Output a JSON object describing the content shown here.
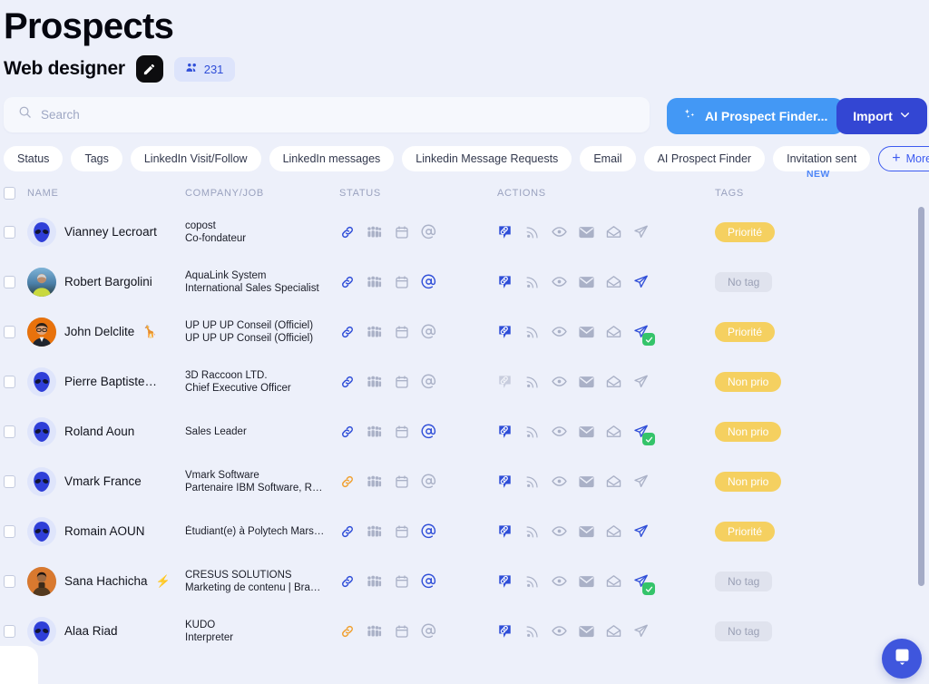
{
  "header": {
    "page_title": "Prospects",
    "campaign_name": "Web designer",
    "edit_icon": "pen-icon",
    "member_count": "231",
    "members_icon": "people-icon"
  },
  "search": {
    "placeholder": "Search",
    "value": "",
    "icon": "search-icon"
  },
  "toolbar": {
    "ai_button_label": "AI Prospect Finder...",
    "ai_button_icon": "sparkles-icon",
    "new_badge": "NEW",
    "import_label": "Import",
    "import_icon": "chevron-down-icon",
    "ai_button_color": "#4398f5",
    "import_button_color": "#3346d3"
  },
  "filters": [
    {
      "label": "Status"
    },
    {
      "label": "Tags"
    },
    {
      "label": "LinkedIn Visit/Follow"
    },
    {
      "label": "LinkedIn messages"
    },
    {
      "label": "Linkedin Message Requests"
    },
    {
      "label": "Email"
    },
    {
      "label": "AI Prospect Finder"
    },
    {
      "label": "Invitation sent"
    }
  ],
  "more_filters": {
    "label": "More filters",
    "icon": "plus-icon",
    "color": "#3d5bf0"
  },
  "table": {
    "columns": [
      "NAME",
      "COMPANY/JOB",
      "STATUS",
      "ACTIONS",
      "TAGS"
    ],
    "status_icons": [
      "link-icon",
      "people-icon",
      "calendar-icon",
      "at-icon"
    ],
    "action_icons": [
      "link-bubble-icon",
      "signal-icon",
      "eye-icon",
      "envelope-icon",
      "open-envelope-icon",
      "paper-plane-icon"
    ],
    "rows": [
      {
        "name": "Vianney Lecroart",
        "emoji": "",
        "avatar": "alien",
        "company": "copost",
        "job": "Co-fondateur",
        "status": [
          "blue",
          "gray",
          "gray",
          "gray"
        ],
        "actions": [
          "active",
          "gray",
          "gray",
          "gray",
          "gray",
          "gray"
        ],
        "sent_check": false,
        "tag": "Priorité",
        "tag_type": "yellow"
      },
      {
        "name": "Robert Bargolini",
        "emoji": "",
        "avatar": "photo-1",
        "company": "AquaLink System",
        "job": "International Sales Specialist",
        "status": [
          "blue",
          "gray",
          "gray",
          "blue"
        ],
        "actions": [
          "active",
          "gray",
          "gray",
          "gray",
          "gray",
          "blue"
        ],
        "sent_check": false,
        "tag": "No tag",
        "tag_type": "none"
      },
      {
        "name": "John Delclite",
        "emoji": "🦒",
        "avatar": "photo-2",
        "company": "UP UP UP Conseil (Officiel)",
        "job": "UP UP UP Conseil (Officiel)",
        "status": [
          "blue",
          "gray",
          "gray",
          "gray"
        ],
        "actions": [
          "active",
          "gray",
          "gray",
          "gray",
          "gray",
          "blue"
        ],
        "sent_check": true,
        "tag": "Priorité",
        "tag_type": "yellow"
      },
      {
        "name": "Pierre Baptiste…",
        "emoji": "",
        "avatar": "alien",
        "company": "3D Raccoon LTD.",
        "job": "Chief Executive Officer",
        "status": [
          "blue",
          "gray",
          "gray",
          "gray"
        ],
        "actions": [
          "gray",
          "gray",
          "gray",
          "gray",
          "gray",
          "gray"
        ],
        "sent_check": false,
        "tag": "Non prio",
        "tag_type": "yellow"
      },
      {
        "name": "Roland Aoun",
        "emoji": "",
        "avatar": "alien",
        "company": "",
        "job": "Sales Leader",
        "status": [
          "blue",
          "gray",
          "gray",
          "blue"
        ],
        "actions": [
          "active",
          "gray",
          "gray",
          "gray",
          "gray",
          "blue"
        ],
        "sent_check": true,
        "tag": "Non prio",
        "tag_type": "yellow"
      },
      {
        "name": "Vmark France",
        "emoji": "",
        "avatar": "alien",
        "company": "Vmark Software",
        "job": "Partenaire IBM Software, R…",
        "status": [
          "orange",
          "gray",
          "gray",
          "gray"
        ],
        "actions": [
          "active",
          "gray",
          "gray",
          "gray",
          "gray",
          "gray"
        ],
        "sent_check": false,
        "tag": "Non prio",
        "tag_type": "yellow"
      },
      {
        "name": "Romain AOUN",
        "emoji": "",
        "avatar": "alien",
        "company": "",
        "job": "Étudiant(e) à Polytech Mars…",
        "status": [
          "blue",
          "gray",
          "gray",
          "blue"
        ],
        "actions": [
          "active",
          "gray",
          "gray",
          "gray",
          "gray",
          "blue"
        ],
        "sent_check": false,
        "tag": "Priorité",
        "tag_type": "yellow"
      },
      {
        "name": "Sana Hachicha",
        "emoji": "⚡",
        "avatar": "photo-3",
        "company": "CRESUS SOLUTIONS",
        "job": "Marketing de contenu | Bra…",
        "status": [
          "blue",
          "gray",
          "gray",
          "blue"
        ],
        "actions": [
          "active",
          "gray",
          "gray",
          "gray",
          "gray",
          "blue"
        ],
        "sent_check": true,
        "tag": "No tag",
        "tag_type": "none"
      },
      {
        "name": "Alaa Riad",
        "emoji": "",
        "avatar": "alien",
        "company": "KUDO",
        "job": "Interpreter",
        "status": [
          "orange",
          "gray",
          "gray",
          "gray"
        ],
        "actions": [
          "active",
          "gray",
          "gray",
          "gray",
          "gray",
          "gray"
        ],
        "sent_check": false,
        "tag": "No tag",
        "tag_type": "none"
      }
    ]
  },
  "widgets": {
    "chat_icon": "chat-bubble-icon",
    "chat_color": "#3f56dd",
    "scrollbar": "vertical-scrollbar"
  },
  "colors": {
    "background": "#edf0fa",
    "accent_blue": "#3346d3",
    "icon_blue": "#2f4ed8",
    "icon_gray": "#aab1c7",
    "icon_orange": "#f0a030",
    "tag_yellow": "#f5d060",
    "check_green": "#35c46a"
  }
}
